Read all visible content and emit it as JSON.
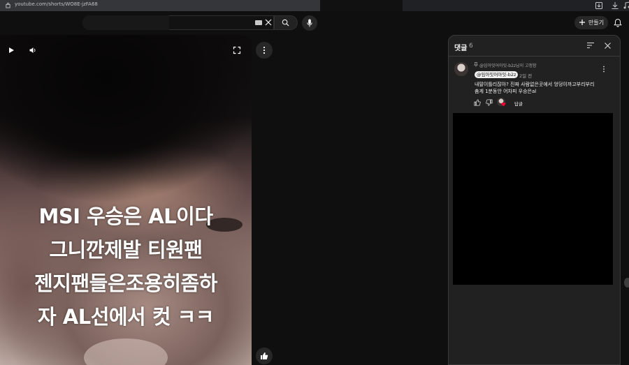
{
  "browser": {
    "url": "youtube.com/shorts/WO8E-jzFA68",
    "icons": [
      "lock-icon",
      "install-icon",
      "download-icon",
      "media-icon"
    ]
  },
  "header": {
    "search": {
      "placeholder": "",
      "value": ""
    },
    "create_label": "만들기",
    "icons": [
      "keyboard-icon",
      "clear-icon",
      "search-icon",
      "mic-icon",
      "plus-icon",
      "bell-icon"
    ]
  },
  "video": {
    "caption_lines": [
      "MSI 우승은 AL이다",
      "그니깐제발 티원팬",
      "젠지팬들은조용히좀하",
      "자 AL선에서 컷 ㅋㅋ"
    ],
    "icons": [
      "play-icon",
      "volume-icon",
      "fullscreen-icon",
      "more-vert-icon",
      "thumbs-up-icon"
    ]
  },
  "comments": {
    "title": "댓글",
    "count": "6",
    "pinned_text": "@임아잇어아잇-b2z님이 고정함",
    "items": [
      {
        "handle": "@임아잇어아잇-b2z",
        "time": "2일 전",
        "text_line1": "내말이틀리잖아? 진짜 사람없은곳에서 엉덩이까고부리부리",
        "text_line2": "춤게 1분동안 어차피 우승은al",
        "reply_label": "답글"
      }
    ]
  },
  "colors": {
    "background": "#0f0f0f",
    "panel": "#212121",
    "heart": "#ff0033"
  }
}
